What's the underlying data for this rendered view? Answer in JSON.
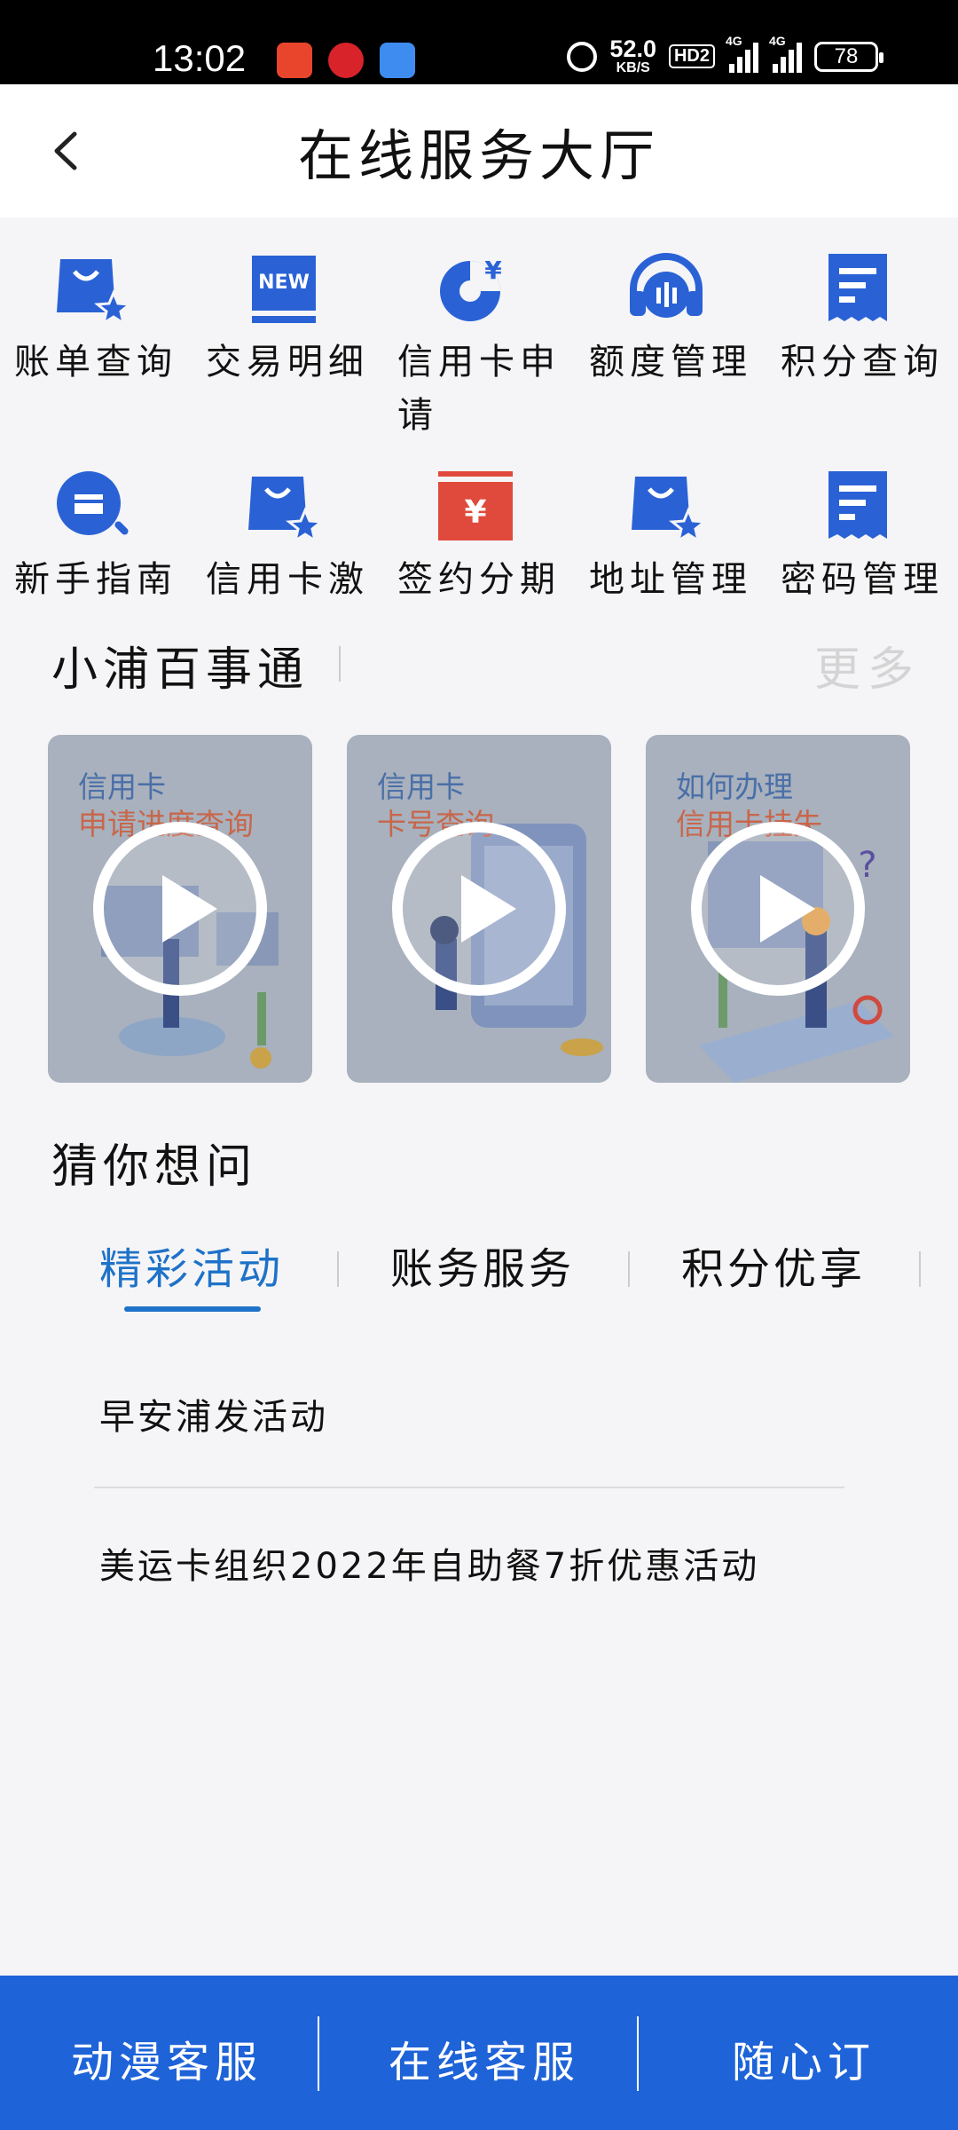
{
  "status_bar": {
    "time": "13:02",
    "net_speed": "52.0",
    "net_unit": "KB/S",
    "hd": "HD2",
    "signal_label": "4G",
    "battery": "78"
  },
  "header": {
    "title": "在线服务大厅",
    "back_icon": "chevron-left-icon"
  },
  "services": [
    {
      "label": "账单查询",
      "icon": "bag-star-icon"
    },
    {
      "label": "交易明细",
      "icon": "new-badge-icon"
    },
    {
      "label": "信用卡申请",
      "icon": "yen-pie-icon"
    },
    {
      "label": "额度管理",
      "icon": "headset-icon"
    },
    {
      "label": "积分查询",
      "icon": "receipt-icon"
    },
    {
      "label": "新手指南",
      "icon": "magnifier-card-icon"
    },
    {
      "label": "信用卡激",
      "icon": "bag-star-icon"
    },
    {
      "label": "签约分期",
      "icon": "yen-envelope-icon"
    },
    {
      "label": "地址管理",
      "icon": "bag-star-icon"
    },
    {
      "label": "密码管理",
      "icon": "receipt-icon"
    }
  ],
  "knowledge": {
    "title": "小浦百事通",
    "more": "更多",
    "videos": [
      {
        "line1": "信用卡",
        "line2": "申请进度查询"
      },
      {
        "line1": "信用卡",
        "line2": "卡号查询"
      },
      {
        "line1": "如何办理",
        "line2": "信用卡挂失"
      }
    ]
  },
  "faq": {
    "title": "猜你想问",
    "tabs": [
      "精彩活动",
      "账务服务",
      "积分优享"
    ],
    "active_tab": 0,
    "items": [
      "早安浦发活动",
      "美运卡组织2022年自助餐7折优惠活动"
    ]
  },
  "bottom_bar": {
    "buttons": [
      "动漫客服",
      "在线客服",
      "随心订"
    ]
  },
  "colors": {
    "accent": "#1e72c8",
    "bottom_bar": "#1e63d8",
    "icon_blue": "#2a62d6",
    "icon_red": "#e04a3c"
  }
}
